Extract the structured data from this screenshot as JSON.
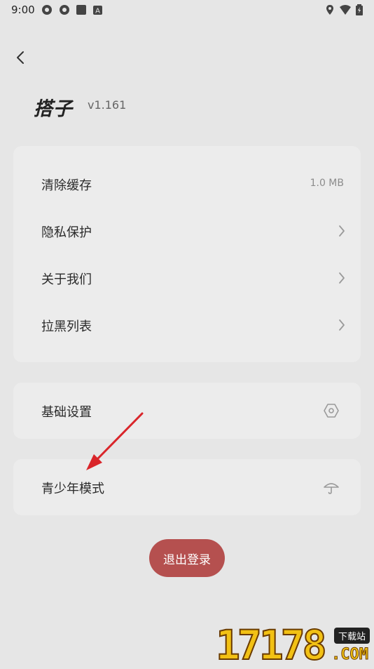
{
  "status_bar": {
    "time": "9:00",
    "left_icons": [
      "app-icon-1",
      "app-icon-2",
      "square-icon",
      "a-icon"
    ],
    "right_icons": [
      "location-icon",
      "wifi-icon",
      "battery-icon"
    ]
  },
  "header": {
    "brand": "搭子",
    "version": "v1.161"
  },
  "card1": {
    "items": [
      {
        "label": "清除缓存",
        "value": "1.0 MB"
      },
      {
        "label": "隐私保护",
        "icon": "chevron-right-icon"
      },
      {
        "label": "关于我们",
        "icon": "chevron-right-icon"
      },
      {
        "label": "拉黑列表",
        "icon": "chevron-right-icon"
      }
    ]
  },
  "card2": {
    "label": "基础设置",
    "icon": "hexagon-settings-icon"
  },
  "card3": {
    "label": "青少年模式",
    "icon": "umbrella-icon"
  },
  "logout": {
    "label": "退出登录"
  },
  "watermark": {
    "number": "17178",
    "tag": "下载站",
    "suffix": ".COM"
  },
  "colors": {
    "background": "#e6e6e6",
    "card": "#ececec",
    "logout": "#b5504f",
    "annotation_arrow": "#d9252a"
  }
}
